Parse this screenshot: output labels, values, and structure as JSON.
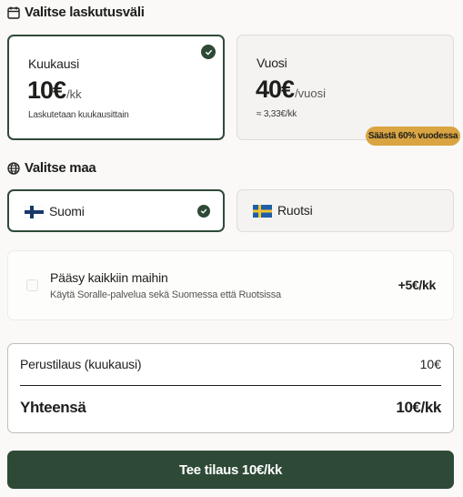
{
  "billing": {
    "heading": "Valitse laskutusväli",
    "plans": [
      {
        "name": "Kuukausi",
        "price": "10€",
        "unit": "/kk",
        "note": "Laskutetaan kuukausittain",
        "selected": true
      },
      {
        "name": "Vuosi",
        "price": "40€",
        "unit": "/vuosi",
        "note": "≈ 3,33€/kk",
        "selected": false
      }
    ],
    "save_badge": "Säästä 60% vuodessa"
  },
  "country": {
    "heading": "Valitse maa",
    "options": [
      {
        "label": "Suomi",
        "flag": "finland-flag",
        "selected": true
      },
      {
        "label": "Ruotsi",
        "flag": "sweden-flag",
        "selected": false
      }
    ]
  },
  "addon": {
    "checked": false,
    "title": "Pääsy kaikkiin maihin",
    "description": "Käytä Soralle-palvelua sekä Suomessa että Ruotsissa",
    "price": "+5€/kk"
  },
  "summary": {
    "line_label": "Perustilaus (kuukausi)",
    "line_value": "10€",
    "total_label": "Yhteensä",
    "total_value": "10€/kk"
  },
  "cta": {
    "label": "Tee tilaus 10€/kk"
  },
  "colors": {
    "accent": "#2e4a37",
    "badge": "#d9a441",
    "background": "#faf9f7"
  }
}
